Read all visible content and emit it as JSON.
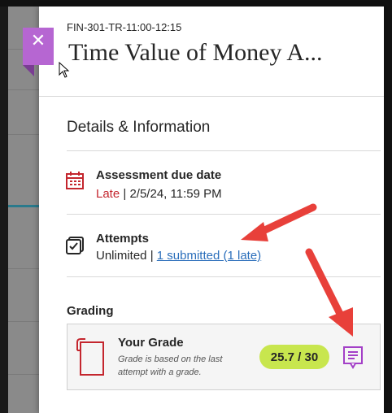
{
  "header": {
    "course_id": "FIN-301-TR-11:00-12:15",
    "title": "Time Value of Money A...",
    "close_icon": "close-icon",
    "close_glyph": "✕"
  },
  "details": {
    "section_title": "Details & Information",
    "due": {
      "icon": "calendar-icon",
      "label": "Assessment due date",
      "status": "Late",
      "separator": "|",
      "date": "2/5/24, 11:59 PM"
    },
    "attempts": {
      "icon": "checkbox-stack-icon",
      "label": "Attempts",
      "allowed": "Unlimited",
      "separator": "|",
      "submitted_link": "1 submitted (1 late)"
    }
  },
  "grading": {
    "section_title": "Grading",
    "card_title": "Your Grade",
    "note": "Grade is based on the last attempt with a grade.",
    "score": "25.7 / 30",
    "feedback_icon": "feedback-icon"
  },
  "colors": {
    "accent_purple": "#b666d2",
    "late_red": "#c4262e",
    "link_blue": "#2a6ebb",
    "grade_pill_green": "#c8e64e",
    "annotation_arrow_red": "#e8403a"
  }
}
